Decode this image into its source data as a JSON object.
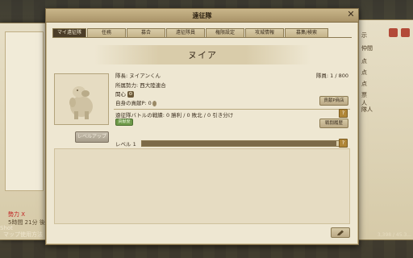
{
  "window": {
    "title": "遠征隊",
    "tabs": [
      {
        "label": "マイ遠征隊",
        "active": true
      },
      {
        "label": "任務",
        "active": false
      },
      {
        "label": "募合",
        "active": false
      },
      {
        "label": "遠征隊員",
        "active": false
      },
      {
        "label": "権限設定",
        "active": false
      },
      {
        "label": "攻城情報",
        "active": false
      },
      {
        "label": "募集/検索",
        "active": false
      }
    ]
  },
  "expedition": {
    "name": "ヌイア",
    "leader": "隊長: ヌイアンくん",
    "faction": "所属勢力: 西大陸連合",
    "interest_label": "関心",
    "contribution": "自身の貢献P: 0",
    "members": "隊員: 1 / 800",
    "battle_record": "遠征隊バトルの戦績: 0 勝利 / 0 敗北 / 0 引き分け",
    "status_tag": "貢献度",
    "level_label": "レベル 1",
    "level_progress": 0.98
  },
  "buttons": {
    "levelup": "レベルアップ",
    "shop": "貢献P商店",
    "history": "戦闘履歴",
    "help": "?"
  },
  "background": {
    "left_text_red": "勢力 X",
    "left_text_time": "5時間 21分 後",
    "left_text_map": "マップ使用方法",
    "left_shot": "Shot",
    "right_rows": [
      "示",
      "仲間",
      "点",
      "点",
      "点",
      "票",
      "人",
      "隊人"
    ],
    "right_stat": "3,398 / 45.3..."
  },
  "colors": {
    "panel": "#eee7d2",
    "title_bar": "#b8a478",
    "tab_active": "#4b3d28",
    "level_fill": "#7c6a48",
    "status_green": "#6e9a4a"
  }
}
